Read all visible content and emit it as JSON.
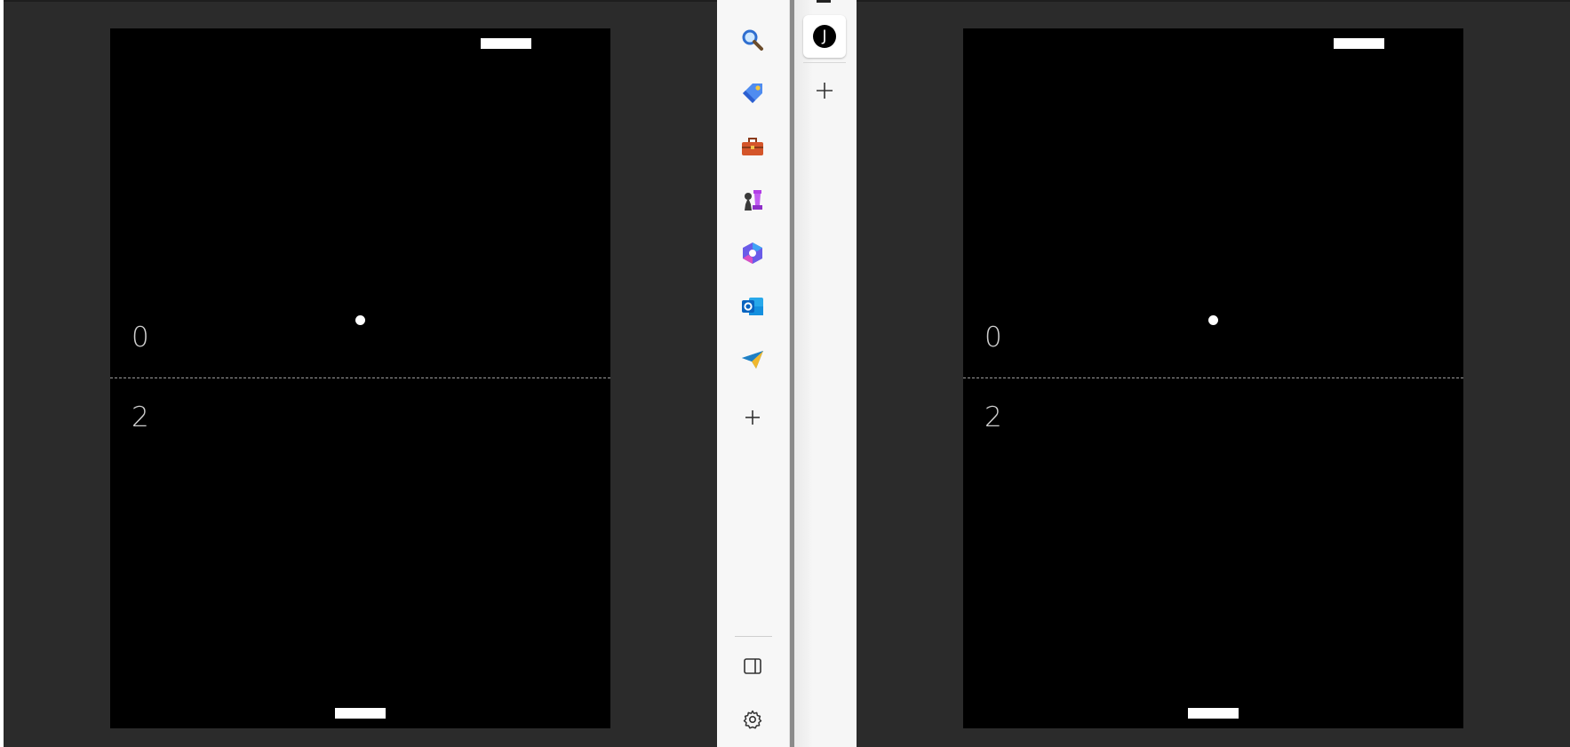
{
  "game": {
    "left": {
      "score_top": "0",
      "score_bottom": "2"
    },
    "right": {
      "score_top": "0",
      "score_bottom": "2"
    }
  },
  "sidebar": {
    "items": [
      {
        "name": "search",
        "icon": "search-icon"
      },
      {
        "name": "shopping",
        "icon": "shopping-tag-icon"
      },
      {
        "name": "tools",
        "icon": "toolbox-icon"
      },
      {
        "name": "games",
        "icon": "chess-icon"
      },
      {
        "name": "microsoft-365",
        "icon": "m365-icon"
      },
      {
        "name": "outlook",
        "icon": "outlook-icon"
      },
      {
        "name": "drop",
        "icon": "paper-plane-icon"
      },
      {
        "name": "add",
        "icon": "plus-icon"
      }
    ],
    "bottom": [
      {
        "name": "hide-sidebar",
        "icon": "panel-icon"
      },
      {
        "name": "settings",
        "icon": "gear-icon"
      }
    ]
  },
  "tabs": {
    "active_avatar_letter": "J"
  },
  "colors": {
    "court": "#000000",
    "background": "#2b2b2b",
    "sidebar": "#f7f7f7"
  }
}
